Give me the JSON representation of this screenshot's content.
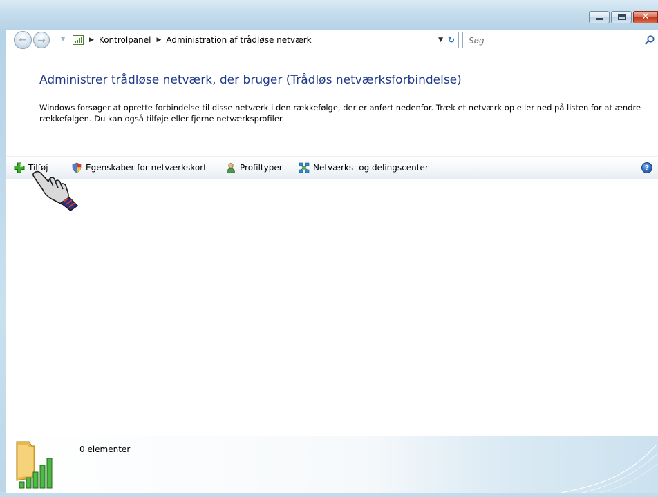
{
  "window": {
    "caption_buttons": {
      "minimize": "minimize",
      "maximize": "maximize",
      "close": "close"
    }
  },
  "navigation": {
    "back_icon": "back-arrow",
    "forward_icon": "forward-arrow",
    "breadcrumbs": [
      "Kontrolpanel",
      "Administration af trådløse netværk"
    ],
    "refresh_icon": "refresh-arrows"
  },
  "search": {
    "placeholder": "Søg"
  },
  "main": {
    "title": "Administrer trådløse netværk, der bruger (Trådløs netværksforbindelse)",
    "description": "Windows forsøger at oprette forbindelse til disse netværk i den rækkefølge, der er anført nedenfor. Træk et netværk op eller ned på listen for at ændre rækkefølgen. Du kan også tilføje eller fjerne netværksprofiler."
  },
  "toolbar": {
    "add_label": "Tilføj",
    "adapter_properties_label": "Egenskaber for netværkskort",
    "profile_types_label": "Profiltyper",
    "network_center_label": "Netværks- og delingscenter",
    "help_icon": "help"
  },
  "details": {
    "item_count": "0 elementer"
  },
  "colors": {
    "title_blue": "#1e3a8a",
    "frame_blue": "#c4dcec",
    "add_green": "#3fae2a"
  }
}
